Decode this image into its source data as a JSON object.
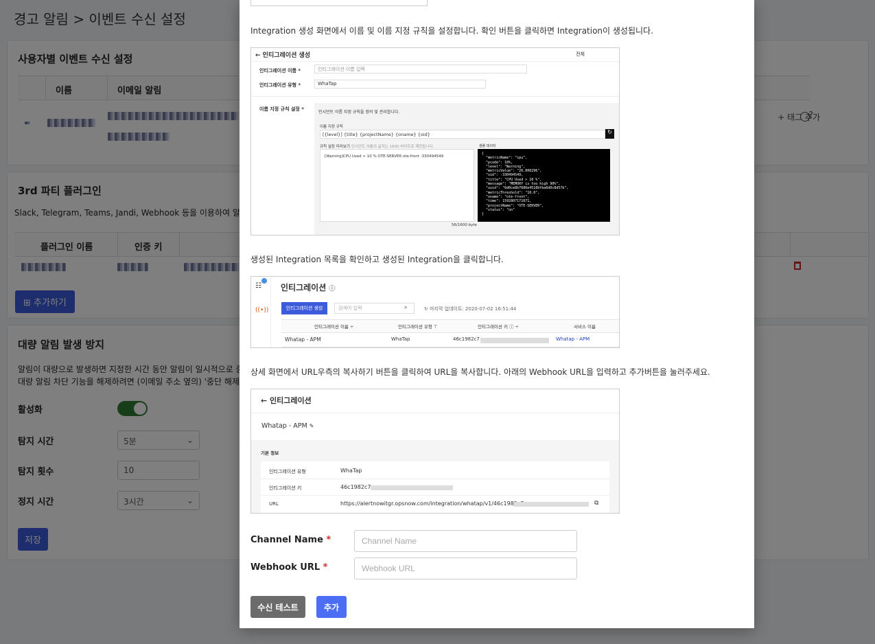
{
  "page": {
    "title": "경고 알림 > 이벤트 수신 설정"
  },
  "user_events": {
    "title": "사용자별 이벤트 수신 설정",
    "columns": [
      "이름",
      "이메일 알림"
    ],
    "tag_add": "+ 태그 추가"
  },
  "plugins": {
    "title": "3rd 파티 플러그인",
    "desc": "Slack, Telegram, Teams, Jandi, Webhook 등을 이용하여 알",
    "columns": [
      "플러그인 이름",
      "인증 키"
    ],
    "add_button": "추가하기"
  },
  "flood": {
    "title": "대량 알림 발생 방지",
    "desc1": "알림이 대량으로 발생하면 지정한 시간 동안 알림이 일시적으로 중",
    "desc2": "대량 알림 차단 기능을 해제하려면 (이메일 주소 옆의) '중단 해제' 버",
    "enable_label": "활성화",
    "detect_time_label": "탐지 시간",
    "detect_time_value": "5분",
    "detect_count_label": "탐지 횟수",
    "detect_count_value": "10",
    "stop_time_label": "정지 시간",
    "stop_time_value": "3시간",
    "save_button": "저장"
  },
  "modal": {
    "step1_text": "Integration 생성 화면에서 이름 및 이름 지정 규칙을 설정합니다. 확인 버튼을 클릭하면 Integration이 생성됩니다.",
    "step2_text": "생성된 Integration 목록을 확인하고 생성된 Integration을 클릭합니다.",
    "step3_text": "상세 화면에서 URL우측의 복사하기 버튼을 클릭하여 URL을 복사합니다. 아래의 Webhook URL을 입력하고 추가버튼을 눌러주세요.",
    "shot1": {
      "header": "← 인티그레이션 생성",
      "help": "전체",
      "name_label": "인티그레이션 이름 *",
      "name_placeholder": "인티그레이션 이름 입력",
      "type_label": "인티그레이션 유형 *",
      "type_value": "WhaTap",
      "rule_label": "이름 지정 규칙 설정 *",
      "rule_desc": "인시던트 이름 지정 규칙을 정의 및 관리합니다.",
      "rule_field_label": "이름 지정 규칙",
      "rule_value": "[{level}] {title} {projectName} {oname} {oid}",
      "preview_label": "규칙 설정 미리보기",
      "preview_hint": "인시던트 이름의 글자는 1600 바이트로 제한됩니다.",
      "preview_value": "[Warning]CPU Used > 10 % OTE-SERVER ote-front -330494549",
      "sample_label": "샘플 데이터",
      "bytes": "56/1600 byte",
      "sample_json": "{\n  \"metricName\": \"cpu\",\n  \"pcode\": 10%,\n  \"level\": \"Warning\",\n  \"metricValue\": \"26.000296\",\n  \"oid\": -330494549,\n  \"title\": \"CPU Used > 10 %\",\n  \"message\": \"MEMORY is too high 90%\",\n  \"uuid\": \"6d0ce8b7686e4518bfba6d0c8d57b\",\n  \"metricThreshold\": \"10.0\",\n  \"oname\": \"ote-front\",\n  \"time\": 1592807171071,\n  \"projectName\": \"OTE-SERVER\",\n  \"status\": \"on\"\n}"
    },
    "shot2": {
      "title": "인티그레이션",
      "create_button": "인티그레이션 생성",
      "search_placeholder": "검색어 입력",
      "last_update": "마지막 업데이트: 2020-07-02 16:51:44",
      "columns": [
        "인티그레이션 이름 ÷",
        "인티그레이션 유형 ⊤",
        "인티그레이션 키 ⓘ ÷",
        "서비스 이름"
      ],
      "row": [
        "Whatap - APM",
        "WhaTap",
        "46c1982c7",
        "Whatap - APM"
      ]
    },
    "shot3": {
      "title": "← 인티그레이션",
      "name": "Whatap - APM",
      "section": "기본 정보",
      "rows": [
        {
          "k": "인티그레이션 유형",
          "v": "WhaTap"
        },
        {
          "k": "인티그레이션 키",
          "v": "46c1982c7"
        },
        {
          "k": "URL",
          "v": "https://alertnowitgr.opsnow.com/integration/whatap/v1/46c1982c7"
        }
      ]
    },
    "channel_label": "Channel Name",
    "channel_placeholder": "Channel Name",
    "webhook_label": "Webhook URL",
    "webhook_placeholder": "Webhook URL",
    "required_mark": "*",
    "test_button": "수신 테스트",
    "add_button": "추가"
  },
  "colors": {
    "primary": "#3b5bdb",
    "gray_button": "#6b6b6b",
    "toggle_on": "#2e7d32",
    "required": "#d32f2f"
  }
}
